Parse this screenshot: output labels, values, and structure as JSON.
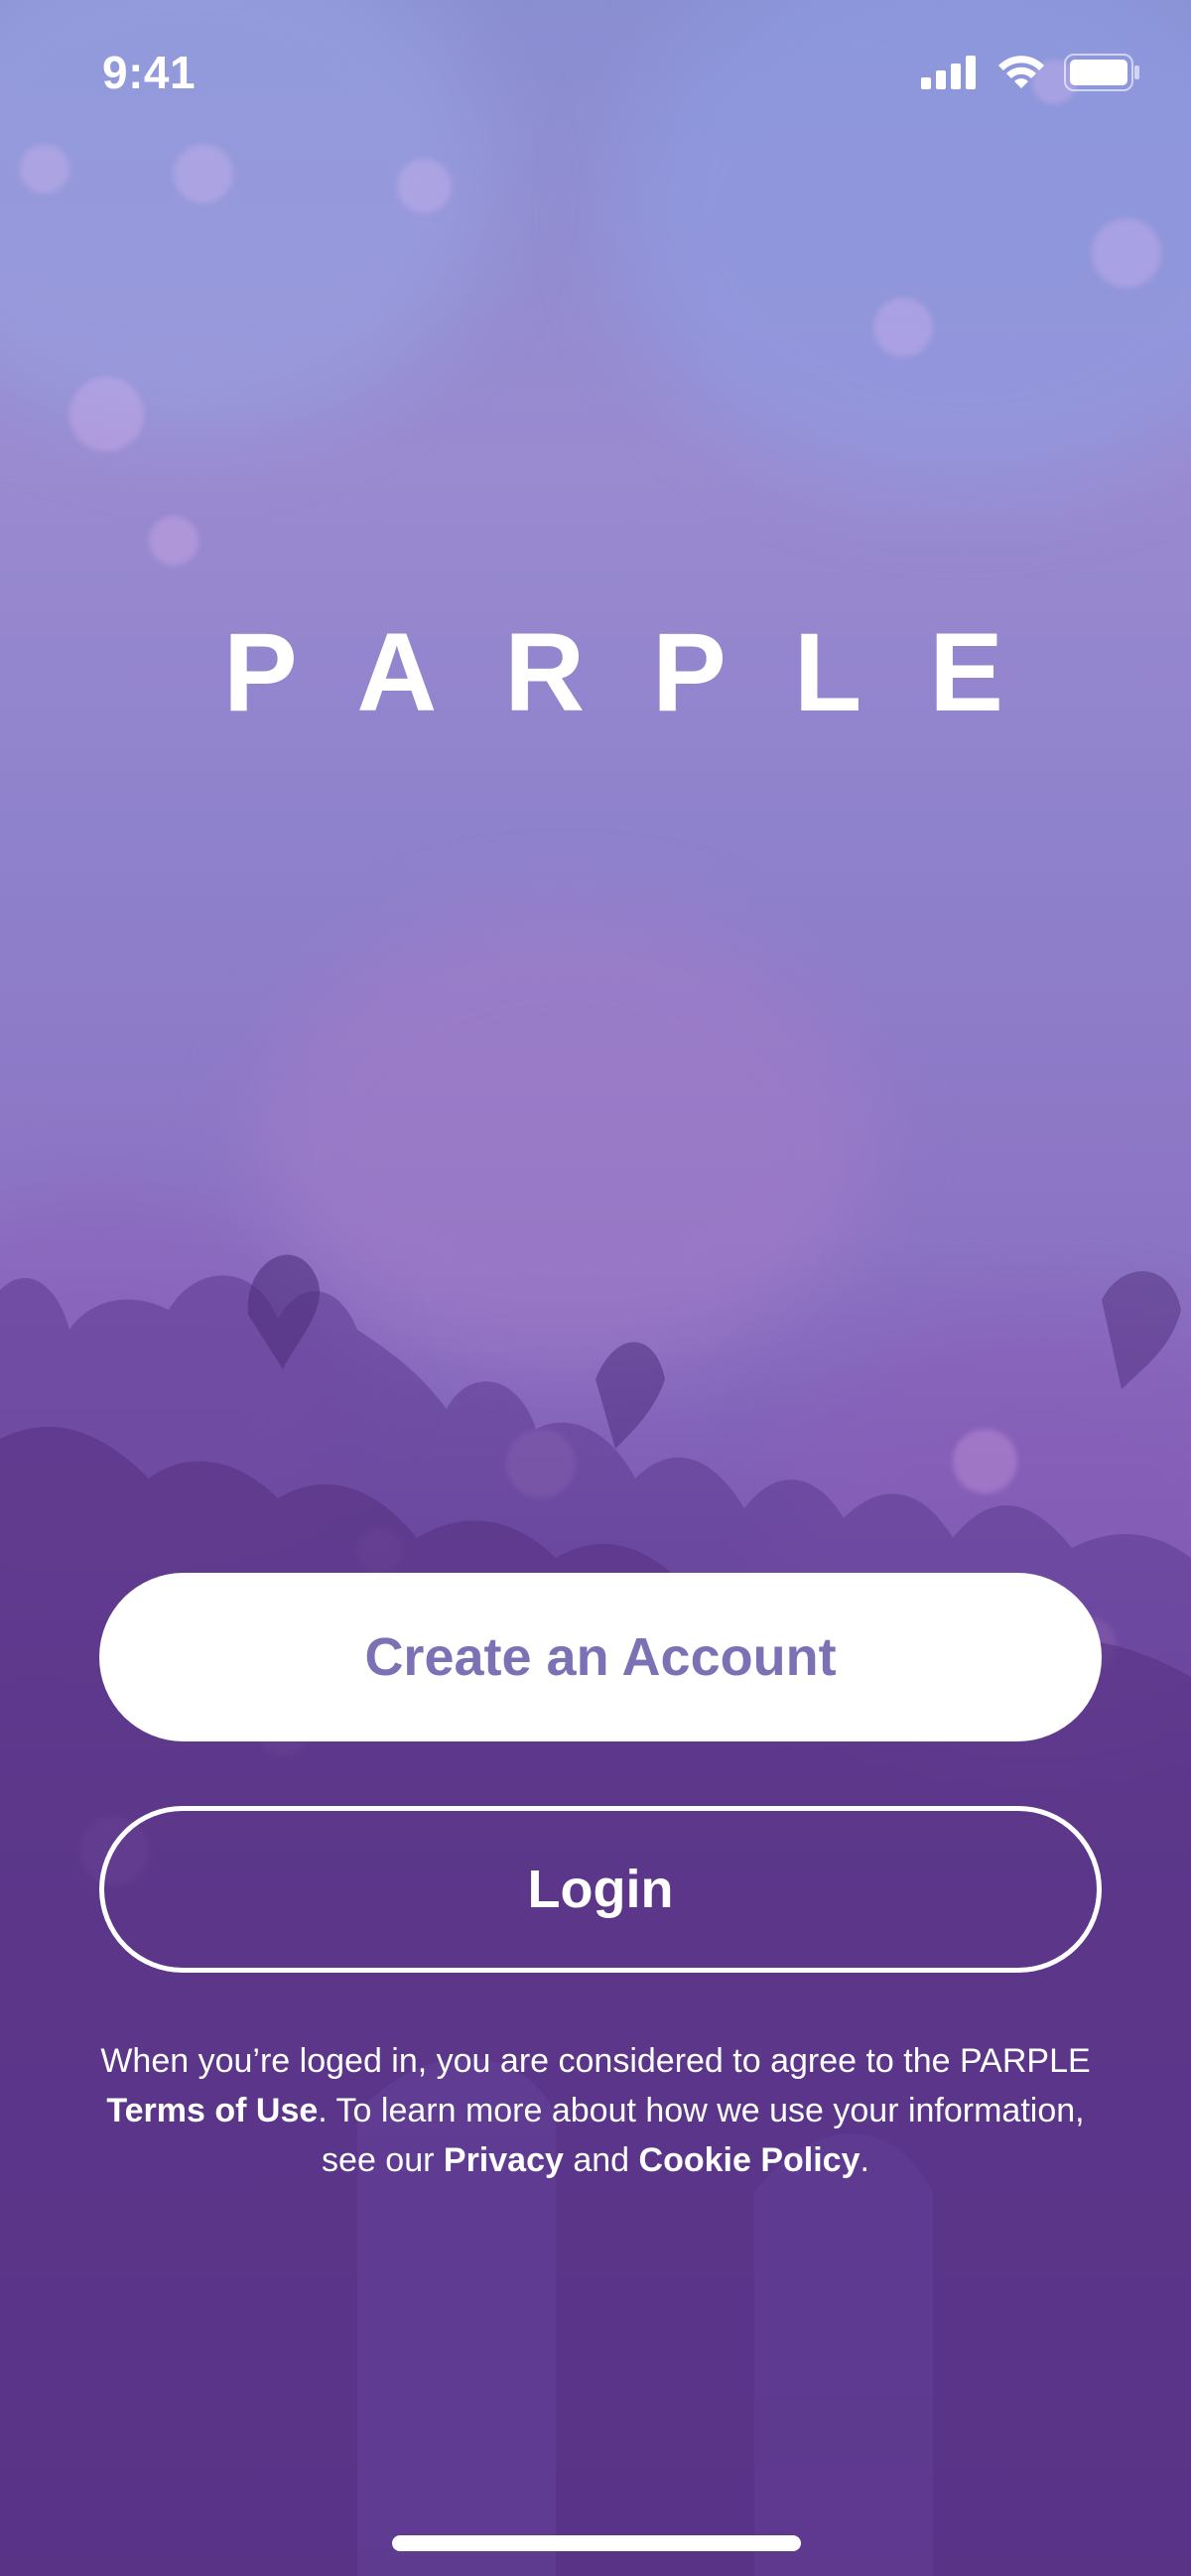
{
  "status_bar": {
    "time": "9:41",
    "icons": [
      "signal-icon",
      "wifi-icon",
      "battery-icon"
    ]
  },
  "brand": {
    "logo_text": "PARPLE"
  },
  "actions": {
    "create_account_label": "Create an Account",
    "login_label": "Login"
  },
  "legal": {
    "intro": "When you’re loged in, you are considered to agree to the PARPLE",
    "terms_link": "Terms of Use",
    "middle": ". To learn more about how we use your information, see our",
    "privacy_link": "Privacy",
    "and": "and",
    "cookie_link": "Cookie Policy",
    "end": "."
  },
  "colors": {
    "accent_text": "#7b72b6",
    "background_top": "#8a8fd2",
    "background_bottom": "#5f378f",
    "button_primary_bg": "#ffffff"
  }
}
